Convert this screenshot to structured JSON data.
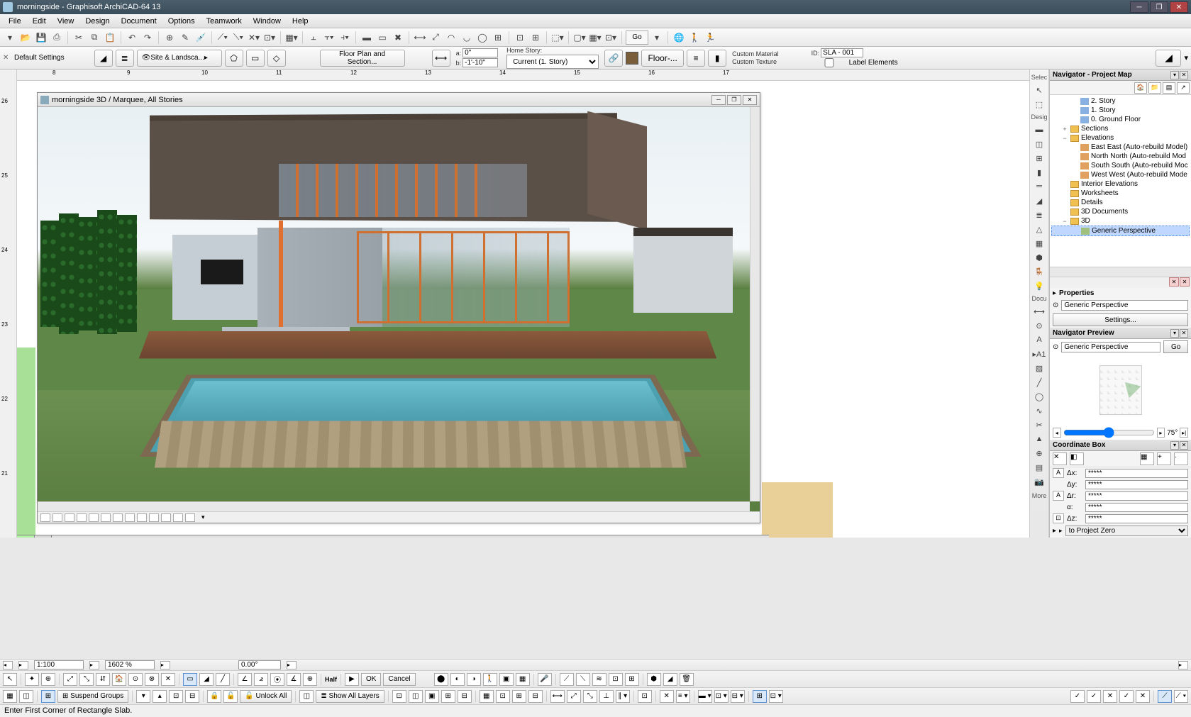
{
  "title": "morningside - Graphisoft ArchiCAD-64 13",
  "menu": [
    "File",
    "Edit",
    "View",
    "Design",
    "Document",
    "Options",
    "Teamwork",
    "Window",
    "Help"
  ],
  "go_button": "Go",
  "infobar": {
    "default_settings": "Default Settings",
    "layer_combo": "Site & Landsca...",
    "fps_button": "Floor Plan and Section...",
    "a_label": "a:",
    "b_label": "b:",
    "a_value": "0\"",
    "b_value": "-1'-10\"",
    "home_story_label": "Home Story:",
    "home_story_value": "Current (1. Story)",
    "floor_material": "Floor-...",
    "custom_material": "Custom Material",
    "custom_texture": "Custom Texture",
    "id_label": "ID:",
    "id_value": "SLA - 001",
    "label_elements": "Label Elements"
  },
  "doc": {
    "title": "morningside 3D / Marquee, All Stories"
  },
  "ruler_h_ticks": [
    "8",
    "9",
    "10",
    "11",
    "12",
    "13",
    "14",
    "15",
    "16",
    "17"
  ],
  "ruler_v_ticks": [
    "26",
    "25",
    "24",
    "23",
    "22",
    "21"
  ],
  "tool_palette": {
    "sel": "Selec",
    "design": "Desig",
    "docu": "Docu",
    "more": "More"
  },
  "navigator": {
    "title": "Navigator - Project Map",
    "tree": [
      {
        "level": 2,
        "icon": "story",
        "label": "2. Story"
      },
      {
        "level": 2,
        "icon": "story",
        "label": "1. Story"
      },
      {
        "level": 2,
        "icon": "story",
        "label": "0. Ground Floor"
      },
      {
        "level": 1,
        "icon": "folder",
        "label": "Sections",
        "exp": "+"
      },
      {
        "level": 1,
        "icon": "folder",
        "label": "Elevations",
        "exp": "−"
      },
      {
        "level": 2,
        "icon": "elev",
        "label": "East East (Auto-rebuild Model)"
      },
      {
        "level": 2,
        "icon": "elev",
        "label": "North North (Auto-rebuild Mod"
      },
      {
        "level": 2,
        "icon": "elev",
        "label": "South South (Auto-rebuild Moc"
      },
      {
        "level": 2,
        "icon": "elev",
        "label": "West West (Auto-rebuild Mode"
      },
      {
        "level": 1,
        "icon": "folder",
        "label": "Interior Elevations"
      },
      {
        "level": 1,
        "icon": "folder",
        "label": "Worksheets"
      },
      {
        "level": 1,
        "icon": "folder",
        "label": "Details"
      },
      {
        "level": 1,
        "icon": "folder",
        "label": "3D Documents"
      },
      {
        "level": 1,
        "icon": "folder",
        "label": "3D",
        "exp": "−"
      },
      {
        "level": 2,
        "icon": "persp",
        "label": "Generic Perspective",
        "selected": true
      }
    ]
  },
  "properties": {
    "title": "Properties",
    "name": "Generic Perspective",
    "settings_btn": "Settings..."
  },
  "nav_preview": {
    "title": "Navigator Preview",
    "name": "Generic Perspective",
    "go": "Go",
    "angle": "75°"
  },
  "coord_box": {
    "title": "Coordinate Box",
    "dx": "Δx:",
    "dy": "Δy:",
    "dr": "Δr:",
    "da": "α:",
    "dz": "Δz:",
    "stars": "*****",
    "link": "to Project Zero"
  },
  "scale_bar": {
    "scale": "1:100",
    "zoom": "1602 %",
    "angle": "0.00°"
  },
  "control_bar": {
    "ok": "OK",
    "cancel": "Cancel",
    "half": "Half",
    "unlock": "Unlock All",
    "show_layers": "Show All Layers",
    "suspend_groups": "Suspend Groups"
  },
  "status": "Enter First Corner of Rectangle Slab."
}
